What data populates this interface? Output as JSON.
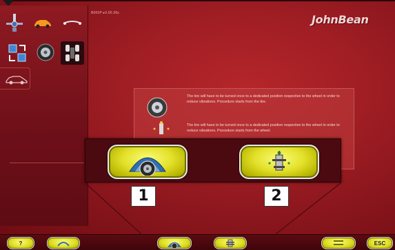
{
  "header": {
    "info_text": "B000P  ▸0.00.36s",
    "brand": "JohnBean"
  },
  "left_panel": {
    "icons": [
      "balancer-icon",
      "car-icon",
      "axle-icon",
      "swap-icon",
      "wheel-icon",
      "tires-icon",
      "car-outline-icon"
    ]
  },
  "info_box": {
    "paragraph_1": "The tire will have to be turned once to a dedicated position respective to the wheel in order to reduce vibrations. Procedure starts from the tire.",
    "paragraph_2": "The tire will have to be turned once to a dedicated position respective to the wheel in order to reduce vibrations. Procedure starts from the wheel."
  },
  "popup": {
    "choice_1_label": "1",
    "choice_2_label": "2"
  },
  "bottom_bar": {
    "help_label": "?",
    "esc_label": "ESC"
  },
  "colors": {
    "background": "#a01e24",
    "button_yellow": "#e3e12a",
    "popup": "#4a0a0f"
  }
}
